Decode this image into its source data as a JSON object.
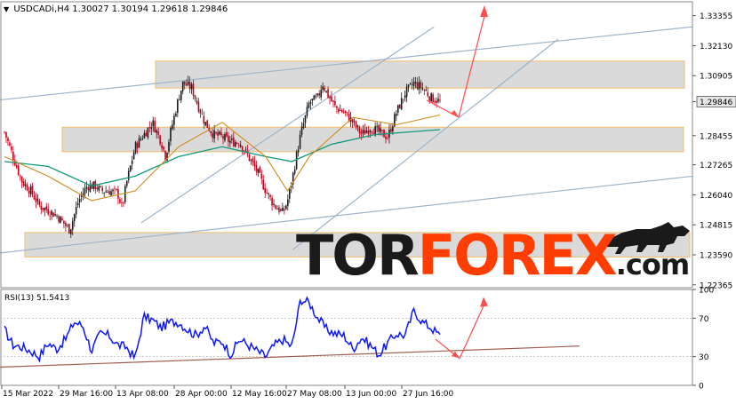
{
  "header": {
    "symbol": "USDCADi,H4",
    "ohlc": "1.30027 1.30194 1.29618 1.29846"
  },
  "rsi_header": {
    "label": "RSI(13) 51.5413"
  },
  "watermark": {
    "part1": "TOR",
    "part2": "FOREX",
    "part3": ".com"
  },
  "colors": {
    "bull_candle": "#1b1b1b",
    "bear_candle": "#c0001a",
    "ma_fast": "#d08a1a",
    "ma_slow": "#11997a",
    "channel": "#9db4cc",
    "zone_fill": "#d6d6d6",
    "zone_border": "#f0b75e",
    "forecast_arrow": "#ff4b4b",
    "rsi_line": "#0c17ff",
    "rsi_trend": "#a05d4f",
    "watermark_accent": "#ff3d00"
  },
  "chart_data": [
    {
      "type": "candlestick",
      "symbol": "USDCADi",
      "timeframe": "H4",
      "x_tick_labels": [
        "15 Mar 2022",
        "29 Mar 16:00",
        "13 Apr 08:00",
        "28 Apr 00:00",
        "12 May 16:00",
        "27 May 08:00",
        "13 Jun 00:00",
        "27 Jun 16:00"
      ],
      "y_tick_labels": [
        "1.33355",
        "1.32130",
        "1.30905",
        "1.29846",
        "1.28455",
        "1.27265",
        "1.26040",
        "1.24815",
        "1.23590",
        "1.22365"
      ],
      "ylim": [
        1.2232,
        1.3385
      ],
      "current_price": 1.29846,
      "close_path": [
        [
          0,
          1.286
        ],
        [
          0.02,
          1.276
        ],
        [
          0.04,
          1.266
        ],
        [
          0.06,
          1.262
        ],
        [
          0.08,
          1.256
        ],
        [
          0.1,
          1.254
        ],
        [
          0.12,
          1.252
        ],
        [
          0.14,
          1.248
        ],
        [
          0.15,
          1.246
        ],
        [
          0.17,
          1.258
        ],
        [
          0.19,
          1.264
        ],
        [
          0.21,
          1.264
        ],
        [
          0.22,
          1.262
        ],
        [
          0.24,
          1.262
        ],
        [
          0.26,
          1.261
        ],
        [
          0.27,
          1.255
        ],
        [
          0.28,
          1.265
        ],
        [
          0.3,
          1.28
        ],
        [
          0.32,
          1.285
        ],
        [
          0.34,
          1.29
        ],
        [
          0.36,
          1.282
        ],
        [
          0.37,
          1.276
        ],
        [
          0.38,
          1.285
        ],
        [
          0.4,
          1.3
        ],
        [
          0.41,
          1.306
        ],
        [
          0.43,
          1.304
        ],
        [
          0.44,
          1.299
        ],
        [
          0.46,
          1.29
        ],
        [
          0.48,
          1.285
        ],
        [
          0.5,
          1.284
        ],
        [
          0.52,
          1.282
        ],
        [
          0.54,
          1.282
        ],
        [
          0.56,
          1.276
        ],
        [
          0.58,
          1.27
        ],
        [
          0.6,
          1.262
        ],
        [
          0.62,
          1.256
        ],
        [
          0.64,
          1.253
        ],
        [
          0.65,
          1.258
        ],
        [
          0.66,
          1.266
        ],
        [
          0.67,
          1.276
        ],
        [
          0.68,
          1.285
        ],
        [
          0.7,
          1.298
        ],
        [
          0.72,
          1.3
        ],
        [
          0.73,
          1.306
        ],
        [
          0.74,
          1.302
        ],
        [
          0.76,
          1.296
        ],
        [
          0.78,
          1.294
        ],
        [
          0.8,
          1.29
        ],
        [
          0.82,
          1.285
        ],
        [
          0.84,
          1.288
        ],
        [
          0.86,
          1.286
        ],
        [
          0.88,
          1.284
        ],
        [
          0.9,
          1.294
        ],
        [
          0.92,
          1.302
        ],
        [
          0.94,
          1.306
        ],
        [
          0.96,
          1.304
        ],
        [
          0.98,
          1.3
        ],
        [
          1,
          1.29846
        ]
      ],
      "ma_fast_path": [
        [
          0,
          1.276
        ],
        [
          0.1,
          1.268
        ],
        [
          0.2,
          1.258
        ],
        [
          0.3,
          1.262
        ],
        [
          0.4,
          1.28
        ],
        [
          0.5,
          1.29
        ],
        [
          0.6,
          1.276
        ],
        [
          0.65,
          1.262
        ],
        [
          0.7,
          1.276
        ],
        [
          0.8,
          1.292
        ],
        [
          0.9,
          1.289
        ],
        [
          1,
          1.293
        ]
      ],
      "ma_slow_path": [
        [
          0,
          1.274
        ],
        [
          0.1,
          1.272
        ],
        [
          0.2,
          1.264
        ],
        [
          0.3,
          1.268
        ],
        [
          0.4,
          1.276
        ],
        [
          0.5,
          1.28
        ],
        [
          0.6,
          1.276
        ],
        [
          0.66,
          1.274
        ],
        [
          0.75,
          1.281
        ],
        [
          0.85,
          1.285
        ],
        [
          1,
          1.287
        ]
      ],
      "zones": [
        {
          "y_top": 1.315,
          "y_bottom": 1.304
        },
        {
          "y_top": 1.288,
          "y_bottom": 1.278
        },
        {
          "y_top": 1.245,
          "y_bottom": 1.235
        }
      ],
      "channel_lines": [
        {
          "x0": -0.01,
          "y0": 1.299,
          "x1": 1.0,
          "y1": 1.329
        },
        {
          "x0": -0.01,
          "y0": 1.2365,
          "x1": 1.0,
          "y1": 1.268
        },
        {
          "x0": 0.2,
          "y0": 1.249,
          "x1": 0.625,
          "y1": 1.329
        },
        {
          "x0": 0.42,
          "y0": 1.238,
          "x1": 0.805,
          "y1": 1.324
        }
      ],
      "forecast": {
        "from": [
          0.97,
          1.299
        ],
        "dip": [
          0.985,
          1.293
        ],
        "target": [
          0.72,
          1.34
        ]
      }
    },
    {
      "type": "line",
      "indicator": "RSI(13)",
      "current_value": 51.5413,
      "y_tick_labels": [
        "100",
        "70",
        "30",
        "0"
      ],
      "ylim": [
        0,
        100
      ],
      "levels": [
        70,
        30
      ],
      "path": [
        [
          0,
          58
        ],
        [
          0.02,
          42
        ],
        [
          0.04,
          40
        ],
        [
          0.06,
          36
        ],
        [
          0.08,
          30
        ],
        [
          0.1,
          44
        ],
        [
          0.12,
          38
        ],
        [
          0.14,
          48
        ],
        [
          0.16,
          66
        ],
        [
          0.18,
          62
        ],
        [
          0.2,
          36
        ],
        [
          0.22,
          54
        ],
        [
          0.24,
          52
        ],
        [
          0.26,
          42
        ],
        [
          0.28,
          40
        ],
        [
          0.3,
          28
        ],
        [
          0.32,
          72
        ],
        [
          0.34,
          68
        ],
        [
          0.36,
          60
        ],
        [
          0.38,
          66
        ],
        [
          0.4,
          66
        ],
        [
          0.42,
          58
        ],
        [
          0.44,
          52
        ],
        [
          0.46,
          62
        ],
        [
          0.48,
          44
        ],
        [
          0.5,
          46
        ],
        [
          0.52,
          32
        ],
        [
          0.54,
          48
        ],
        [
          0.56,
          42
        ],
        [
          0.58,
          36
        ],
        [
          0.6,
          30
        ],
        [
          0.62,
          42
        ],
        [
          0.64,
          48
        ],
        [
          0.66,
          40
        ],
        [
          0.68,
          90
        ],
        [
          0.7,
          86
        ],
        [
          0.72,
          70
        ],
        [
          0.74,
          58
        ],
        [
          0.76,
          54
        ],
        [
          0.78,
          52
        ],
        [
          0.8,
          38
        ],
        [
          0.82,
          50
        ],
        [
          0.84,
          42
        ],
        [
          0.86,
          32
        ],
        [
          0.88,
          44
        ],
        [
          0.9,
          54
        ],
        [
          0.92,
          52
        ],
        [
          0.94,
          78
        ],
        [
          0.96,
          66
        ],
        [
          0.98,
          60
        ],
        [
          1,
          51.5
        ]
      ],
      "trend_line": {
        "x0": -0.07,
        "y0": 18,
        "x1": 1.32,
        "y1": 41
      },
      "forecast": {
        "from": [
          0.99,
          48
        ],
        "dip": [
          1.045,
          28
        ],
        "target": [
          1.1,
          92
        ]
      }
    }
  ]
}
